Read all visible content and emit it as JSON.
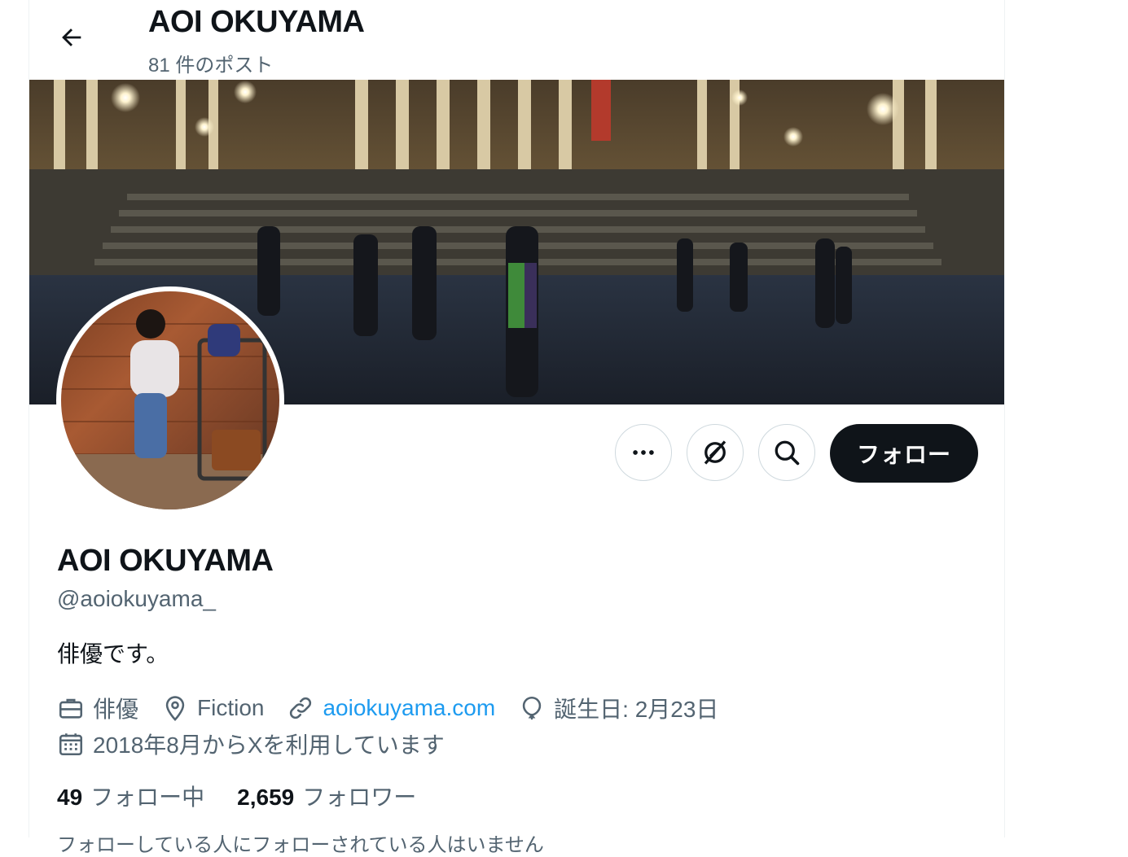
{
  "header": {
    "title": "AOI OKUYAMA",
    "post_count": "81 件のポスト"
  },
  "banner": {
    "description": "night photo of columned building with stairs and people"
  },
  "actions": {
    "follow_label": "フォロー"
  },
  "profile": {
    "name": "AOI OKUYAMA",
    "handle": "@aoiokuyama_",
    "bio": "俳優です。",
    "profession": "俳優",
    "location": "Fiction",
    "website": "aoiokuyama.com",
    "birthday": "誕生日: 2月23日",
    "joined": "2018年8月からXを利用しています"
  },
  "stats": {
    "following_count": "49",
    "following_label": "フォロー中",
    "followers_count": "2,659",
    "followers_label": "フォロワー"
  },
  "footer_partial": "フォローしている人にフォローされている人はいません"
}
